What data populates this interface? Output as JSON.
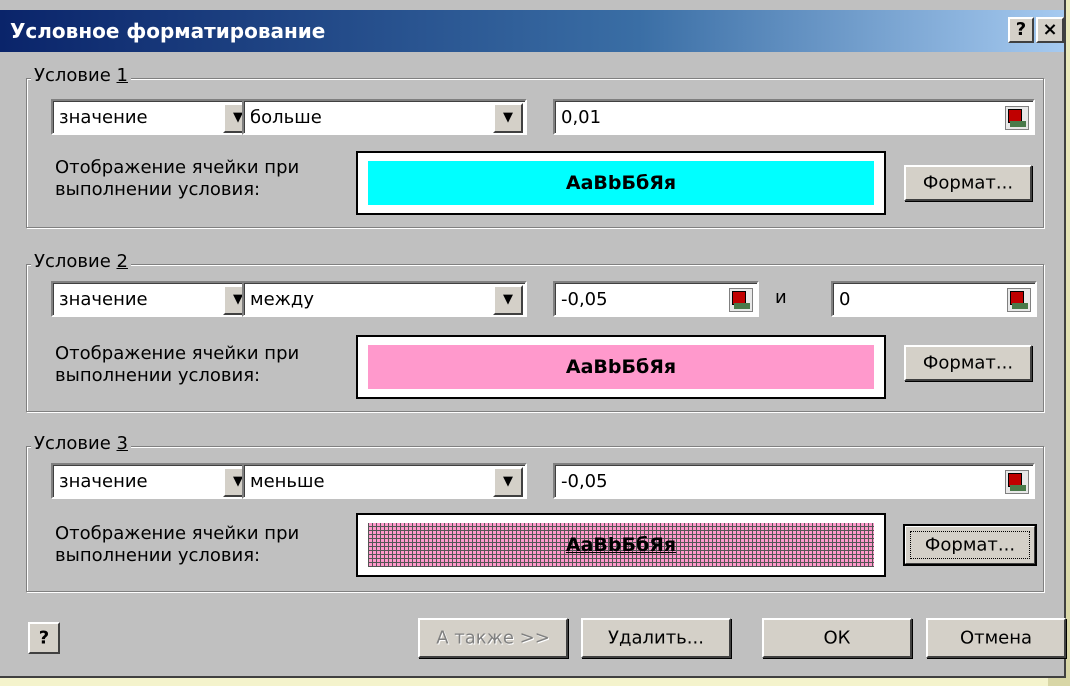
{
  "dialog": {
    "title": "Условное форматирование",
    "help_button": "?",
    "close_button": "×"
  },
  "conditions": [
    {
      "legend_prefix": "Условие ",
      "legend_key": "1",
      "type_value": "значение",
      "operator_value": "больше",
      "value1": "0,01",
      "preview_label": "Отображение ячейки при выполнении условия:",
      "preview_text": "АаBbБбЯя",
      "preview_color": "#00ffff",
      "format_button": "Формат..."
    },
    {
      "legend_prefix": "Условие ",
      "legend_key": "2",
      "type_value": "значение",
      "operator_value": "между",
      "value1": "-0,05",
      "and_label": "и",
      "value2": "0",
      "preview_label": "Отображение ячейки при выполнении условия:",
      "preview_text": "АаBbБбЯя",
      "preview_color": "#ff99cc",
      "format_button": "Формат..."
    },
    {
      "legend_prefix": "Условие ",
      "legend_key": "3",
      "type_value": "значение",
      "operator_value": "меньше",
      "value1": "-0,05",
      "preview_label": "Отображение ячейки при выполнении условия:",
      "preview_text": "АаBbБбЯя",
      "preview_color": "#ff99cc",
      "preview_pattern": "grid",
      "format_button": "Формат..."
    }
  ],
  "footer": {
    "help_icon_label": "?",
    "also_button": "А также >>",
    "delete_button": "Удалить...",
    "ok_button": "ОК",
    "cancel_button": "Отмена"
  },
  "icons": {
    "dropdown": "chevron-down-icon",
    "range_select": "range-select-icon",
    "help": "help-icon"
  }
}
